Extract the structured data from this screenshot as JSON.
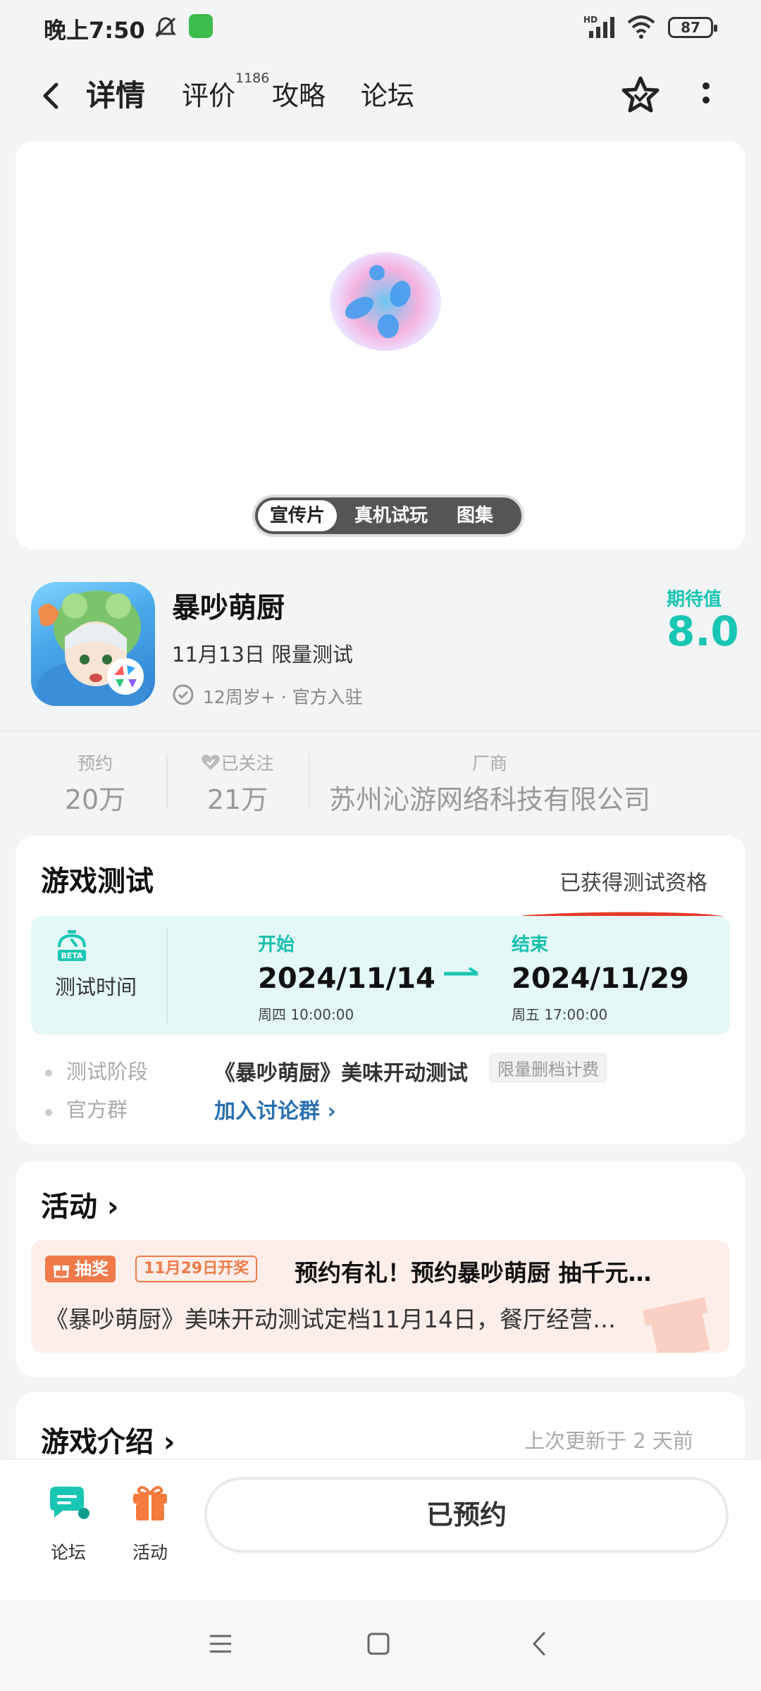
{
  "status_bar": {
    "time": "晚上7:50",
    "battery": "87",
    "network": "HD"
  },
  "nav": {
    "tabs": [
      "详情",
      "评价",
      "攻略",
      "论坛"
    ],
    "review_count": "1186"
  },
  "media": {
    "tabs": [
      "宣传片",
      "真机试玩",
      "图集"
    ],
    "active_tab": "宣传片"
  },
  "game": {
    "title": "暴吵萌厨",
    "test_date": "11月13日  限量测试",
    "age_info": "12周岁+ · 官方入驻",
    "expect_label": "期待值",
    "expect_score": "8.0"
  },
  "stats": {
    "reserve": {
      "label": "预约",
      "value": "20万"
    },
    "follow": {
      "label": "已关注",
      "value": "21万"
    },
    "vendor": {
      "label": "厂商",
      "value": "苏州沁游网络科技有限公司"
    }
  },
  "test": {
    "title": "游戏测试",
    "status": "已获得测试资格",
    "time_label": "测试时间",
    "start": {
      "label": "开始",
      "date": "2024/11/14",
      "sub": "周四  10:00:00"
    },
    "end": {
      "label": "结束",
      "date": "2024/11/29",
      "sub": "周五  17:00:00"
    },
    "stage_label": "测试阶段",
    "stage_value": "《暴吵萌厨》美味开动测试",
    "stage_tag": "限量删档计费",
    "group_label": "官方群",
    "group_link": "加入讨论群 ›"
  },
  "activity": {
    "title": "活动 ›",
    "tag": "抽奖",
    "draw_date": "11月29日开奖",
    "headline": "预约有礼！预约暴吵萌厨 抽千元…",
    "description": "《暴吵萌厨》美味开动测试定档11月14日，餐厅经营…"
  },
  "intro": {
    "title": "游戏介绍 ›",
    "updated": "上次更新于 2 天前"
  },
  "bottom_bar": {
    "forum_label": "论坛",
    "activity_label": "活动",
    "reserve_button": "已预约"
  },
  "colors": {
    "accent": "#19c6b4",
    "orange": "#f07a4a",
    "link": "#2a6fb0"
  }
}
